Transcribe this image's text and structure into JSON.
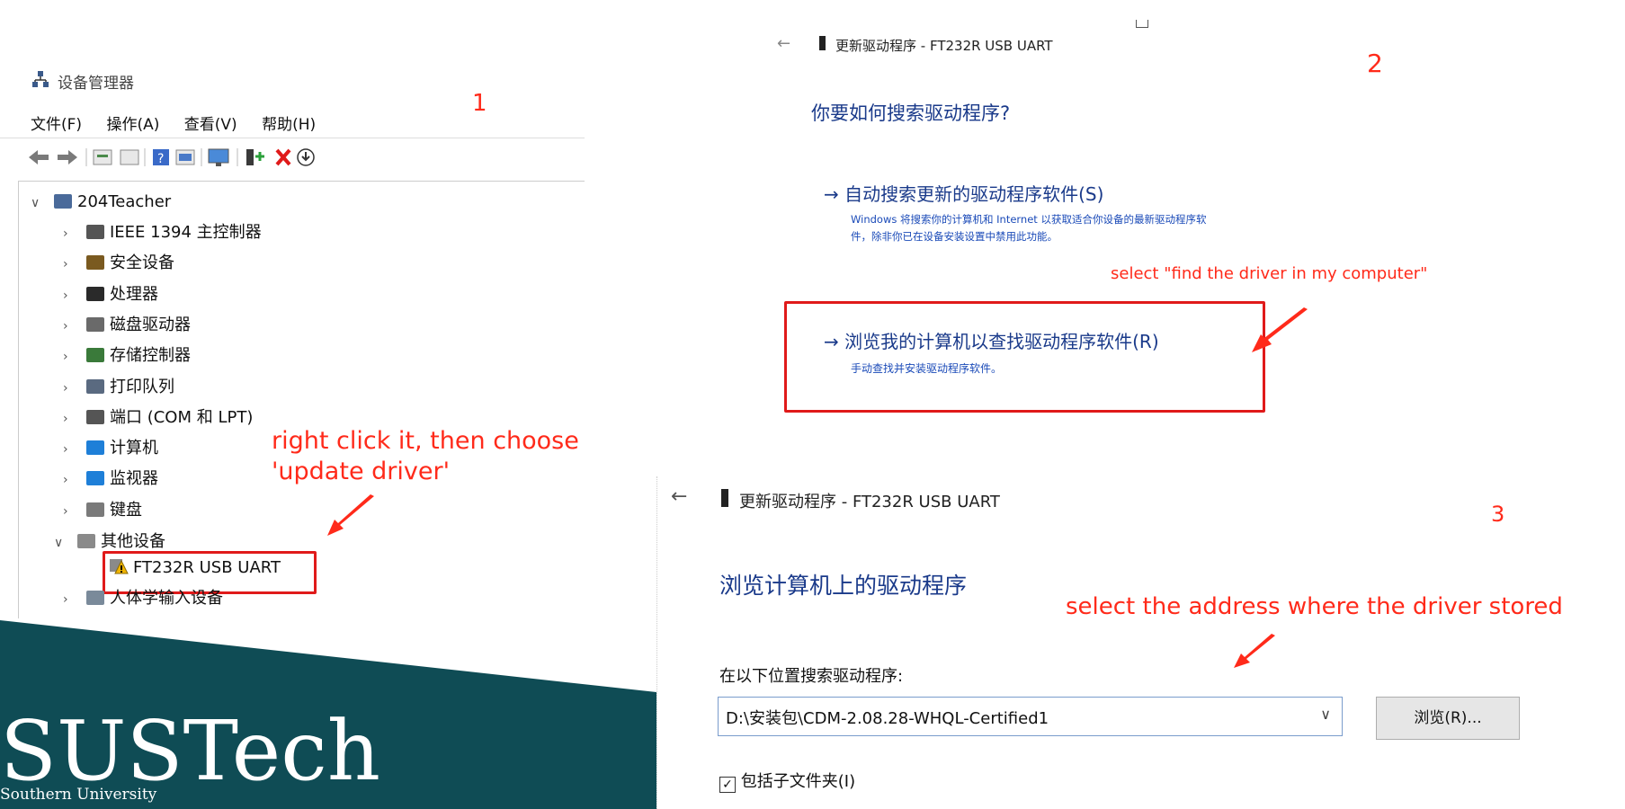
{
  "panel1": {
    "window_title": "设备管理器",
    "step_number": "1",
    "menu": [
      "文件(F)",
      "操作(A)",
      "查看(V)",
      "帮助(H)"
    ],
    "toolbar_icons": [
      "back-arrow-icon",
      "forward-arrow-icon",
      "properties-icon",
      "show-hidden-icon",
      "help-icon",
      "view-icon",
      "monitor-icon",
      "add-driver-icon",
      "uninstall-icon",
      "update-icon"
    ],
    "root_node": "204Teacher",
    "tree_items": [
      {
        "label": "IEEE 1394 主控制器",
        "icon": "ieee1394-icon",
        "color": "#555555"
      },
      {
        "label": "安全设备",
        "icon": "security-device-icon",
        "color": "#7a5a20"
      },
      {
        "label": "处理器",
        "icon": "processor-icon",
        "color": "#2a2a2a"
      },
      {
        "label": "磁盘驱动器",
        "icon": "disk-drive-icon",
        "color": "#6a6a6a"
      },
      {
        "label": "存储控制器",
        "icon": "storage-controller-icon",
        "color": "#3a7a3a"
      },
      {
        "label": "打印队列",
        "icon": "print-queue-icon",
        "color": "#5a6a80"
      },
      {
        "label": "端口 (COM 和 LPT)",
        "icon": "port-icon",
        "color": "#555555"
      },
      {
        "label": "计算机",
        "icon": "computer-icon",
        "color": "#1e7fd8"
      },
      {
        "label": "监视器",
        "icon": "monitor-icon",
        "color": "#1e7fd8"
      },
      {
        "label": "键盘",
        "icon": "keyboard-icon",
        "color": "#7a7a7a"
      }
    ],
    "other_devices": "其他设备",
    "ft232r_item": "FT232R USB UART",
    "hid_item": "人体学输入设备",
    "annotation_line1": "right click it, then choose",
    "annotation_line2": "'update driver'"
  },
  "panel2": {
    "title": "更新驱动程序 - FT232R USB UART",
    "step_number": "2",
    "question": "你要如何搜索驱动程序?",
    "option_auto_title": "自动搜索更新的驱动程序软件(S)",
    "option_auto_desc_line1": "Windows 将搜索你的计算机和 Internet 以获取适合你设备的最新驱动程序软",
    "option_auto_desc_line2": "件，除非你已在设备安装设置中禁用此功能。",
    "option_browse_title": "浏览我的计算机以查找驱动程序软件(R)",
    "option_browse_desc": "手动查找并安装驱动程序软件。",
    "annotation": "select \"find the driver in my computer\""
  },
  "panel3": {
    "title": "更新驱动程序 - FT232R USB UART",
    "step_number": "3",
    "heading": "浏览计算机上的驱动程序",
    "annotation": "select the address where the driver stored",
    "search_label": "在以下位置搜索驱动程序:",
    "path_value": "D:\\安装包\\CDM-2.08.28-WHQL-Certified1",
    "browse_button": "浏览(R)...",
    "include_subfolders": "包括子文件夹(I)",
    "include_subfolders_checked": true
  },
  "logo": {
    "name": "SUSTech",
    "subtitle": "Southern University",
    "band_color": "#0f4c55"
  }
}
